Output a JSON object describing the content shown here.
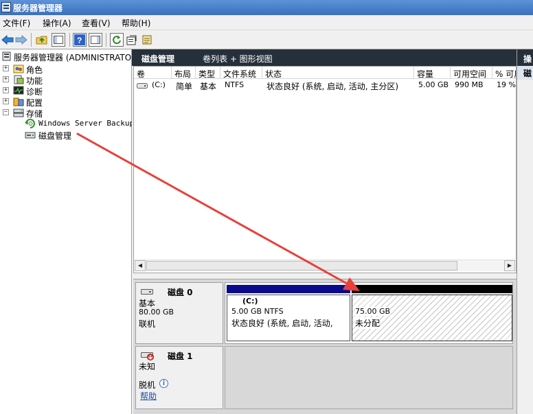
{
  "window": {
    "title": "服务器管理器"
  },
  "menu": [
    "文件(F)",
    "操作(A)",
    "查看(V)",
    "帮助(H)"
  ],
  "toolbar": {
    "icons": [
      "back-icon",
      "forward-icon",
      "up-folder-icon",
      "show-hide-tree-icon",
      "help-icon",
      "show-hide-action-pane-icon",
      "refresh-icon",
      "properties-icon",
      "export-icon"
    ]
  },
  "tree": {
    "root": "服务器管理器 (ADMINISTRATOR)",
    "items": [
      {
        "label": "角色",
        "expander": "+"
      },
      {
        "label": "功能",
        "expander": "+"
      },
      {
        "label": "诊断",
        "expander": "+"
      },
      {
        "label": "配置",
        "expander": "+"
      },
      {
        "label": "存储",
        "expander": "−"
      }
    ],
    "storage_children": [
      "Windows Server Backup",
      "磁盘管理"
    ]
  },
  "main": {
    "title": "磁盘管理",
    "subtitle": "卷列表 + 图形视图",
    "columns": [
      "卷",
      "布局",
      "类型",
      "文件系统",
      "状态",
      "容量",
      "可用空间",
      "% 可用"
    ],
    "rows": [
      {
        "volume": "(C:)",
        "layout": "简单",
        "type": "基本",
        "fs": "NTFS",
        "status": "状态良好 (系统, 启动, 活动, 主分区)",
        "capacity": "5.00 GB",
        "free": "990 MB",
        "pct": "19 %"
      }
    ]
  },
  "disks": [
    {
      "name": "磁盘 0",
      "type": "基本",
      "size": "80.00 GB",
      "status": "联机",
      "partitions": [
        {
          "name": "(C:)",
          "size": "5.00 GB NTFS",
          "status": "状态良好 (系统, 启动, 活动,",
          "bar_color": "#0a0a8c"
        },
        {
          "name": "",
          "size": "75.00 GB",
          "status": "未分配",
          "bar_color": "#000000"
        }
      ]
    },
    {
      "name": "磁盘 1",
      "type": "未知",
      "status": "脱机",
      "help": "帮助"
    }
  ],
  "actions": {
    "header": "操",
    "item": "磁"
  },
  "colors": {
    "title_bar": "#3b6fbd",
    "pane_header": "#26303a",
    "annotation_arrow": "#e8403a",
    "primary_partition": "#0a0a8c",
    "unallocated": "#000000"
  }
}
